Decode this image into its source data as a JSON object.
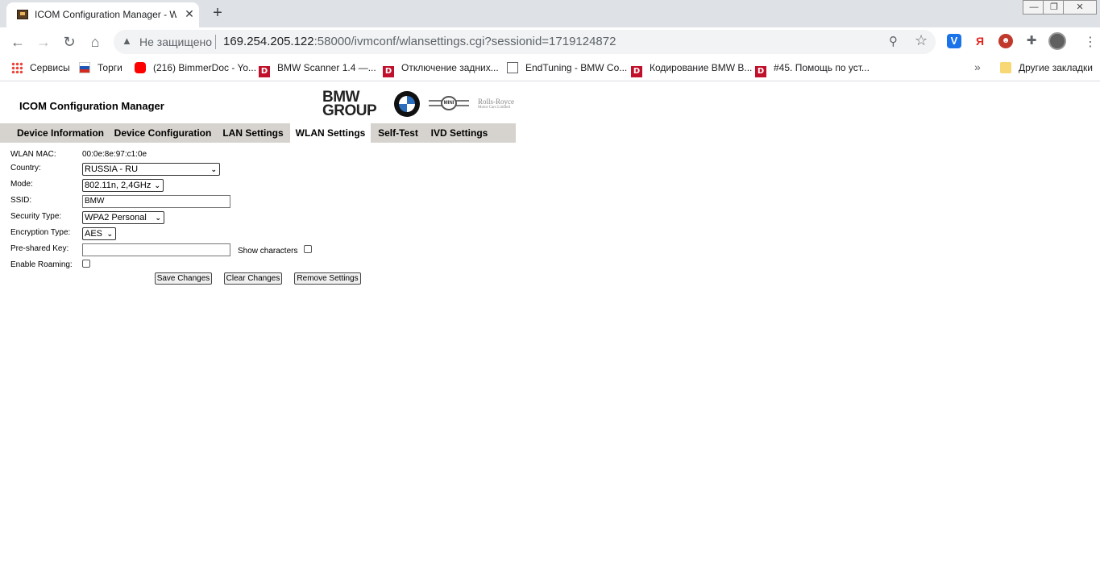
{
  "browser": {
    "tab_title": "ICOM Configuration Manager - WLAN",
    "not_secure": "Не защищено",
    "url_host": "169.254.205.122",
    "url_rest": ":58000/ivmconf/wlansettings.cgi?sessionid=1719124872",
    "bookmarks": [
      {
        "label": "Сервисы",
        "icon": "apps-grid-icon"
      },
      {
        "label": "Торги",
        "icon": "flag-icon"
      },
      {
        "label": "(216) BimmerDoc - Yo...",
        "icon": "youtube-icon"
      },
      {
        "label": "BMW Scanner 1.4 —...",
        "icon": "d-icon"
      },
      {
        "label": "Отключение задних...",
        "icon": "d-icon"
      },
      {
        "label": "EndTuning - BMW Co...",
        "icon": "page-icon"
      },
      {
        "label": "Кодирование BMW B...",
        "icon": "d-icon"
      },
      {
        "label": "#45. Помощь по уст...",
        "icon": "d-icon"
      }
    ],
    "more_bookmarks": "»",
    "other_bookmarks": "Другие закладки",
    "ext_ya": "Я"
  },
  "page": {
    "title": "ICOM Configuration Manager",
    "logo_group": "BMW GROUP",
    "logo_group_l1": "BMW",
    "logo_group_l2": "GROUP",
    "logo_mini": "MINI",
    "logo_rr_l1": "Rolls-Royce",
    "logo_rr_l2": "Motor Cars Limited",
    "nav": [
      {
        "label": "Device Information",
        "active": false
      },
      {
        "label": "Device Configuration",
        "active": false
      },
      {
        "label": "LAN Settings",
        "active": false
      },
      {
        "label": "WLAN Settings",
        "active": true
      },
      {
        "label": "Self-Test",
        "active": false
      },
      {
        "label": "IVD Settings",
        "active": false
      }
    ]
  },
  "form": {
    "wlan_mac_label": "WLAN MAC:",
    "wlan_mac_value": "00:0e:8e:97:c1:0e",
    "country_label": "Country:",
    "country_value": "RUSSIA - RU",
    "mode_label": "Mode:",
    "mode_value": "802.11n, 2,4GHz",
    "ssid_label": "SSID:",
    "ssid_value": "BMW",
    "security_label": "Security Type:",
    "security_value": "WPA2 Personal",
    "encryption_label": "Encryption Type:",
    "encryption_value": "AES",
    "psk_label": "Pre-shared Key:",
    "psk_value": "",
    "show_chars_label": "Show characters",
    "show_chars_checked": false,
    "roaming_label": "Enable Roaming:",
    "roaming_checked": false,
    "save_button": "Save Changes",
    "clear_button": "Clear Changes",
    "remove_button": "Remove Settings"
  }
}
